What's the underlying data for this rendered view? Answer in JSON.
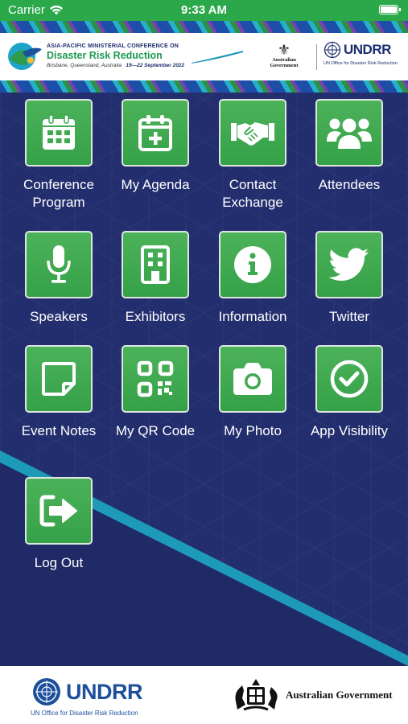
{
  "status_bar": {
    "carrier": "Carrier",
    "time": "9:33 AM"
  },
  "header": {
    "conference_line1": "ASIA-PACIFIC MINISTERIAL CONFERENCE ON",
    "conference_title": "Disaster Risk Reduction",
    "location": "Brisbane, Queensland, Australia",
    "dates": "19—22 September 2022",
    "gov_label": "Australian Government",
    "undrr_name": "UNDRR",
    "undrr_sub": "UN Office for Disaster Risk Reduction"
  },
  "menu": {
    "items": [
      {
        "id": "conference-program",
        "label": "Conference Program",
        "icon": "calendar-icon"
      },
      {
        "id": "my-agenda",
        "label": "My Agenda",
        "icon": "calendar-plus-icon"
      },
      {
        "id": "contact-exchange",
        "label": "Contact Exchange",
        "icon": "handshake-icon"
      },
      {
        "id": "attendees",
        "label": "Attendees",
        "icon": "users-icon"
      },
      {
        "id": "speakers",
        "label": "Speakers",
        "icon": "microphone-icon"
      },
      {
        "id": "exhibitors",
        "label": "Exhibitors",
        "icon": "building-icon"
      },
      {
        "id": "information",
        "label": "Information",
        "icon": "info-icon"
      },
      {
        "id": "twitter",
        "label": "Twitter",
        "icon": "twitter-icon"
      },
      {
        "id": "event-notes",
        "label": "Event Notes",
        "icon": "sticky-note-icon"
      },
      {
        "id": "my-qr-code",
        "label": "My QR Code",
        "icon": "qr-code-icon"
      },
      {
        "id": "my-photo",
        "label": "My Photo",
        "icon": "camera-icon"
      },
      {
        "id": "app-visibility",
        "label": "App Visibility",
        "icon": "check-circle-icon"
      },
      {
        "id": "log-out",
        "label": "Log Out",
        "icon": "logout-icon"
      }
    ]
  },
  "footer": {
    "undrr_name": "UNDRR",
    "undrr_sub": "UN Office for Disaster Risk Reduction",
    "gov_label": "Australian Government"
  },
  "colors": {
    "status_bar": "#2aa84a",
    "background": "#232e6e",
    "tile": "#3fa94f",
    "accent_stripe": "#1d9ab8"
  }
}
